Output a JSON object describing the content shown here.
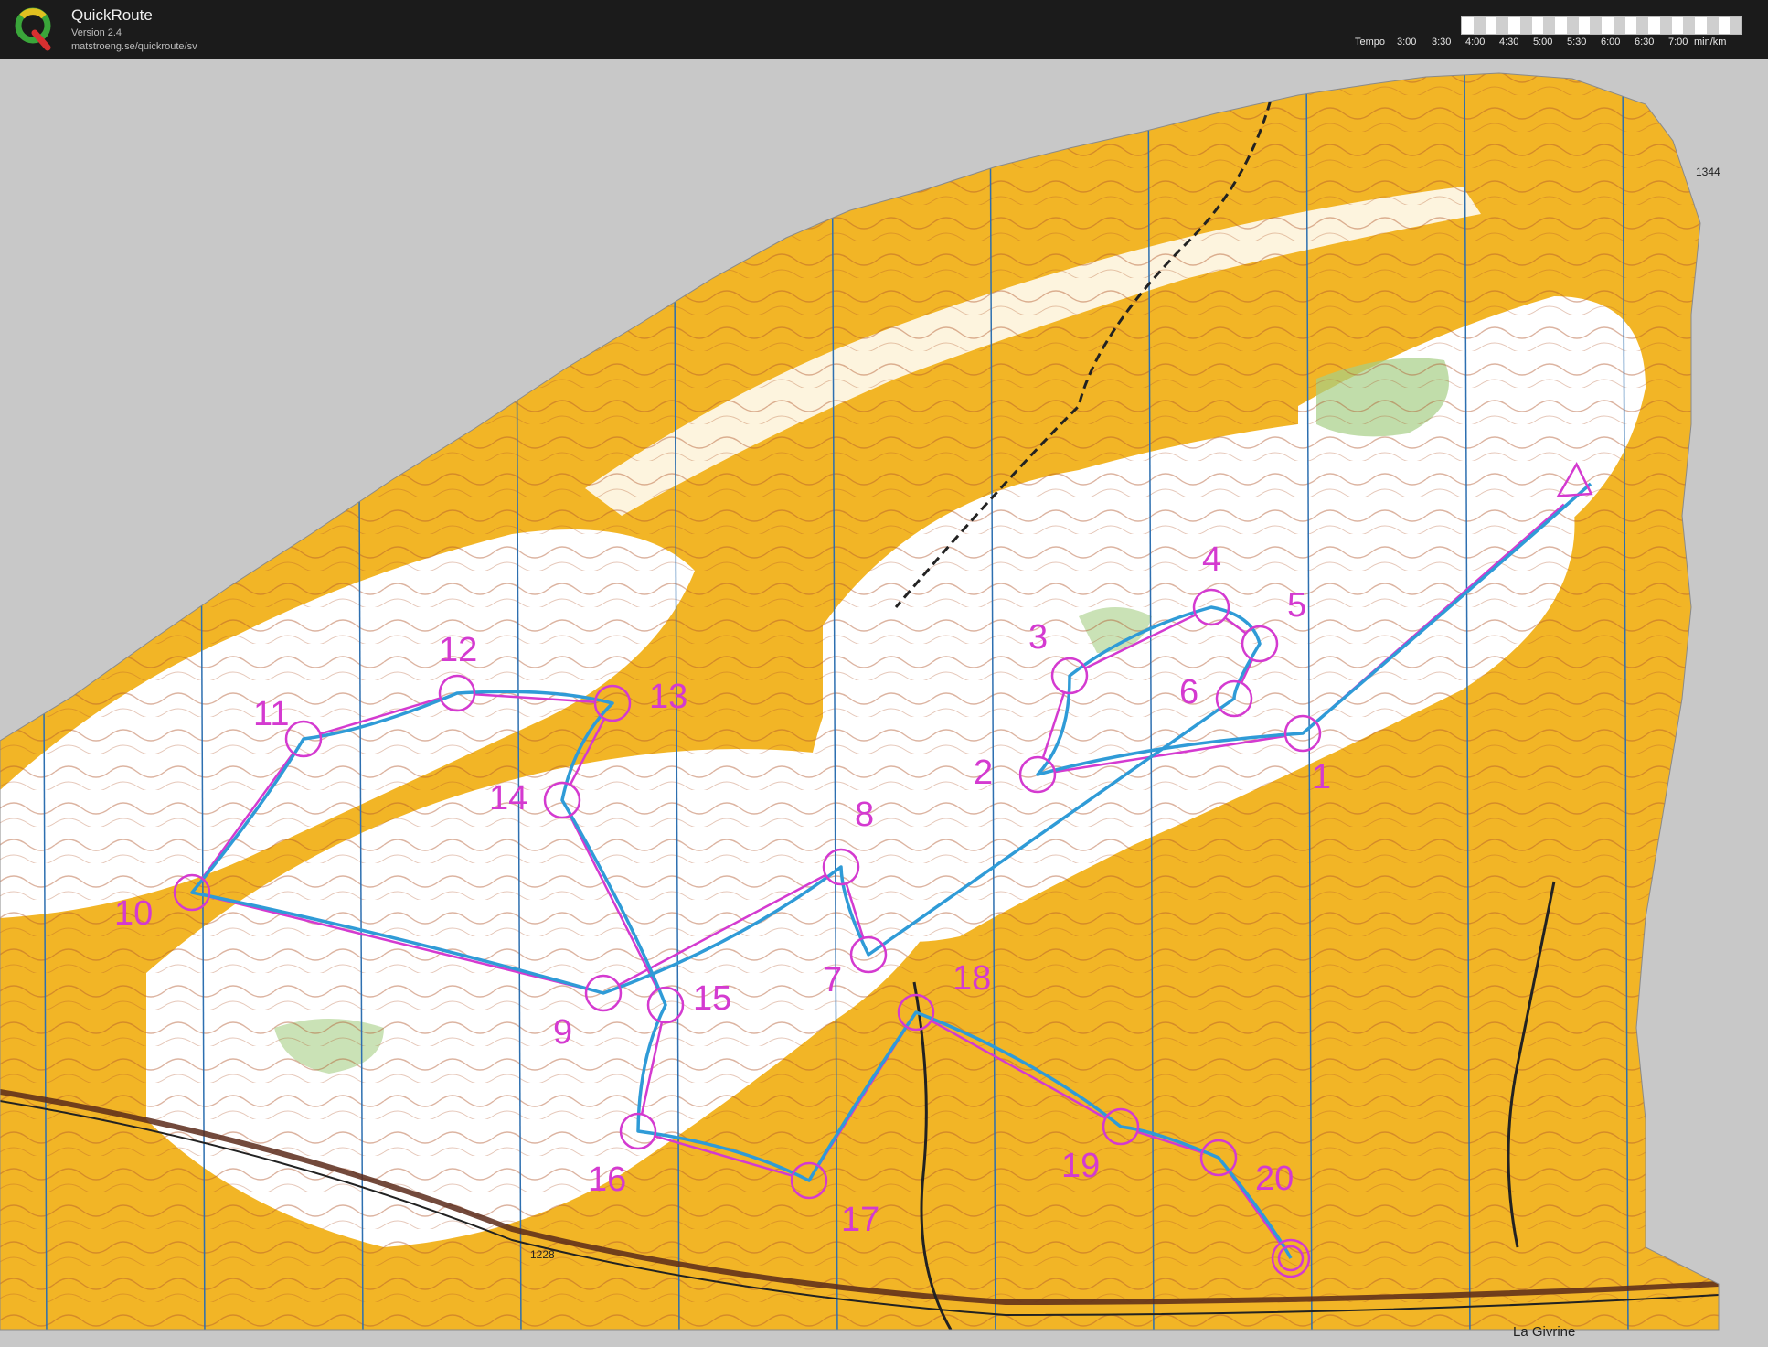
{
  "app": {
    "name": "QuickRoute",
    "version": "Version 2.4",
    "url": "matstroeng.se/quickroute/sv",
    "logo_letter": "Q"
  },
  "tempo": {
    "label": "Tempo",
    "ticks": [
      "3:00",
      "3:30",
      "4:00",
      "4:30",
      "5:00",
      "5:30",
      "6:00",
      "6:30",
      "7:00"
    ],
    "unit": "min/km"
  },
  "map": {
    "place_label": "La Givrine",
    "spot_heights": [
      "1344",
      "1228"
    ],
    "controls": [
      "1",
      "2",
      "3",
      "4",
      "5",
      "6",
      "7",
      "8",
      "9",
      "10",
      "11",
      "12",
      "13",
      "14",
      "15",
      "16",
      "17",
      "18",
      "19",
      "20"
    ],
    "colors": {
      "open_land": "#f2b526",
      "forest": "#ffffff",
      "green": "#a6cf86",
      "contour": "#b0552a",
      "course": "#d43ad0",
      "route": "#2f9bd7",
      "background": "#c8c8c8"
    }
  }
}
